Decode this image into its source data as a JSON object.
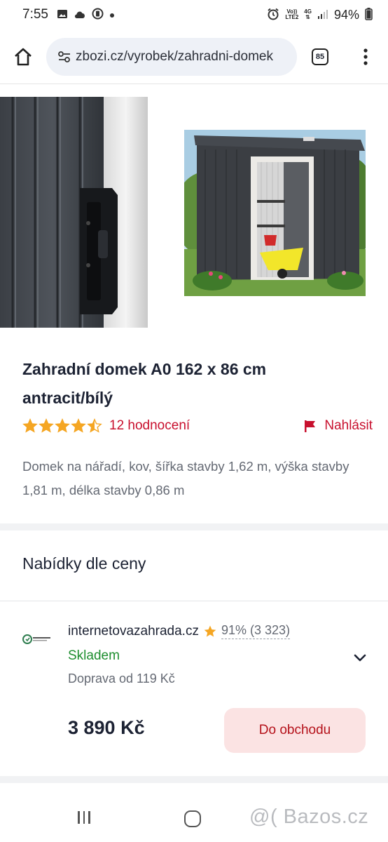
{
  "status_bar": {
    "time": "7:55",
    "network_top": "Vo))",
    "network_bottom": "LTE2",
    "data_type": "4G",
    "battery": "94%"
  },
  "browser": {
    "url": "zbozi.cz/vyrobek/zahradni-domek",
    "tabs_count": "85"
  },
  "product": {
    "title_line1": "Zahradní domek A0 162 x 86 cm",
    "title_line2": "antracit/bílý",
    "rating_value": 4.5,
    "rating_max": 5,
    "reviews_label": "12 hodnocení",
    "report_label": "Nahlásit",
    "description": "Domek na nářadí, kov, šířka stavby 1,62 m, výška stavby 1,81 m, délka stavby 0,86 m"
  },
  "offers": {
    "section_title": "Nabídky dle ceny",
    "items": [
      {
        "shop_name": "internetovazahrada.cz",
        "shop_rating": "91% (3 323)",
        "stock": "Skladem",
        "shipping": "Doprava od 119 Kč",
        "price": "3 890 Kč",
        "button_label": "Do obchodu"
      }
    ]
  },
  "watermark": "@( Bazos.cz",
  "colors": {
    "accent_red": "#c8102e",
    "star_gold": "#f5a623",
    "stock_green": "#1e8e2f",
    "button_bg": "#fbe3e3"
  },
  "icons": [
    "home-icon",
    "tune-icon",
    "tabs-icon",
    "more-vert-icon",
    "star-icon",
    "flag-icon",
    "chevron-down-icon"
  ]
}
